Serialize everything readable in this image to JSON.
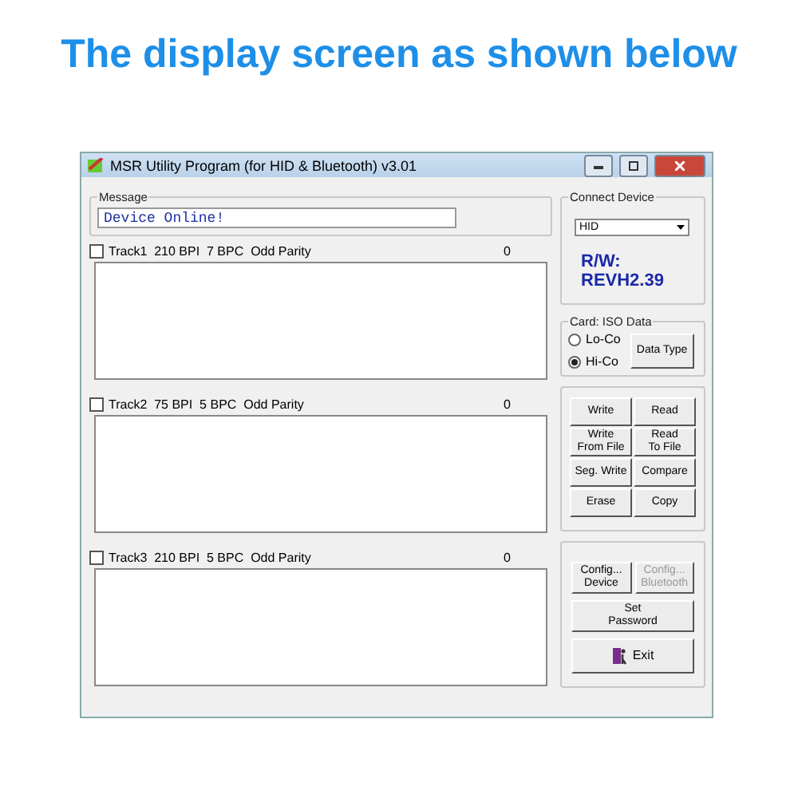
{
  "headline": "The display screen as shown below",
  "window": {
    "title": "MSR Utility Program (for HID & Bluetooth) v3.01"
  },
  "message": {
    "label": "Message",
    "value": "Device Online!"
  },
  "tracks": [
    {
      "label": "Track1  210 BPI  7 BPC  Odd Parity",
      "checked": false,
      "count": "0"
    },
    {
      "label": "Track2  75 BPI  5 BPC  Odd Parity",
      "checked": false,
      "count": "0"
    },
    {
      "label": "Track3  210 BPI  5 BPC  Odd Parity",
      "checked": false,
      "count": "0"
    }
  ],
  "connect_device": {
    "label": "Connect Device",
    "device": "HID",
    "firmware": "R/W: REVH2.39"
  },
  "card": {
    "label": "Card: ISO Data",
    "options": [
      {
        "label": "Lo-Co",
        "selected": false
      },
      {
        "label": "Hi-Co",
        "selected": true
      }
    ],
    "button": "Data Type"
  },
  "action_buttons": [
    {
      "lines": [
        "Write"
      ]
    },
    {
      "lines": [
        "Read"
      ]
    },
    {
      "lines": [
        "Write",
        "From File"
      ]
    },
    {
      "lines": [
        "Read",
        "To File"
      ]
    },
    {
      "lines": [
        "Seg. Write"
      ]
    },
    {
      "lines": [
        "Compare"
      ]
    },
    {
      "lines": [
        "Erase"
      ]
    },
    {
      "lines": [
        "Copy"
      ]
    }
  ],
  "config_buttons": [
    {
      "lines": [
        "Config...",
        "Device"
      ],
      "disabled": false
    },
    {
      "lines": [
        "Config...",
        "Bluetooth"
      ],
      "disabled": true
    }
  ],
  "password_button": {
    "lines": [
      "Set",
      "Password"
    ]
  },
  "exit_button": {
    "label": "Exit"
  }
}
